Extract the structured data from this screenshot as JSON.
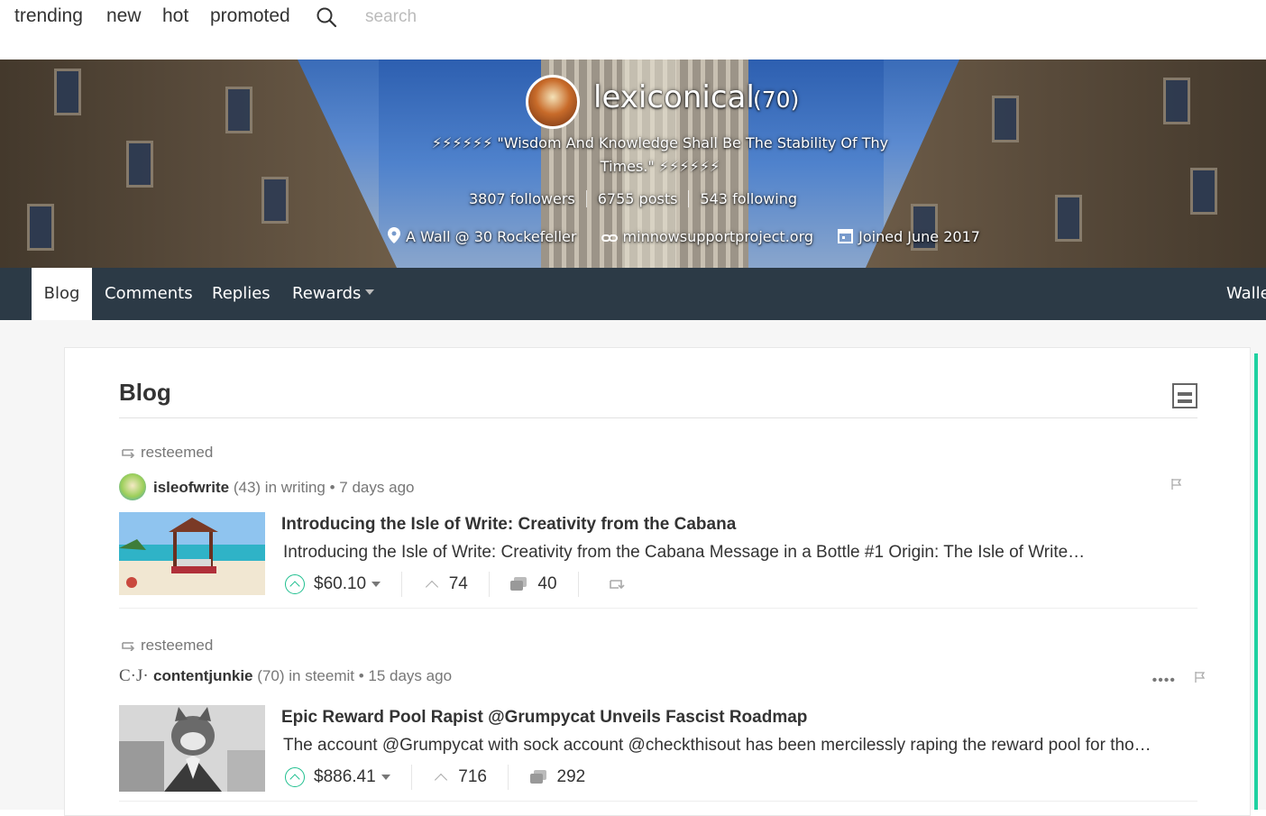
{
  "topnav": {
    "links": [
      "trending",
      "new",
      "hot",
      "promoted"
    ],
    "search_placeholder": "search"
  },
  "profile": {
    "username": "lexiconical",
    "reputation": "(70)",
    "about": "⚡⚡⚡⚡⚡⚡ \"Wisdom And Knowledge Shall Be The Stability Of Thy Times.\" ⚡⚡⚡⚡⚡⚡",
    "followers": "3807 followers",
    "posts": "6755 posts",
    "following": "543 following",
    "location": "A Wall @ 30 Rockefeller",
    "website": "minnowsupportproject.org",
    "joined": "Joined June 2017"
  },
  "tabs": {
    "blog": "Blog",
    "comments": "Comments",
    "replies": "Replies",
    "rewards": "Rewards",
    "wallet": "Walle"
  },
  "blog": {
    "title": "Blog",
    "posts": [
      {
        "resteem_label": "resteemed",
        "author": "isleofwrite",
        "author_rep": "(43)",
        "category_prefix": "in",
        "category": "writing",
        "time": "• 7 days ago",
        "title": "Introducing the Isle of Write: Creativity from the Cabana",
        "summary": "Introducing the Isle of Write: Creativity from the Cabana Message in a Bottle #1 Origin: The Isle of Write…",
        "payout": "$60.10",
        "votes": "74",
        "comments": "40"
      },
      {
        "resteem_label": "resteemed",
        "author": "contentjunkie",
        "author_rep": "(70)",
        "category_prefix": "in",
        "category": "steemit",
        "time": "• 15 days ago",
        "title": "Epic Reward Pool Rapist @Grumpycat Unveils Fascist Roadmap",
        "summary": "The account @Grumpycat with sock account @checkthisout has been mercilessly raping the reward pool for tho…",
        "payout": "$886.41",
        "votes": "716",
        "comments": "292",
        "avatar_text": "C·J·",
        "menu_dots": "••••"
      }
    ]
  },
  "colors": {
    "accent": "#1fd1a1",
    "tabbar": "#2c3a46"
  }
}
